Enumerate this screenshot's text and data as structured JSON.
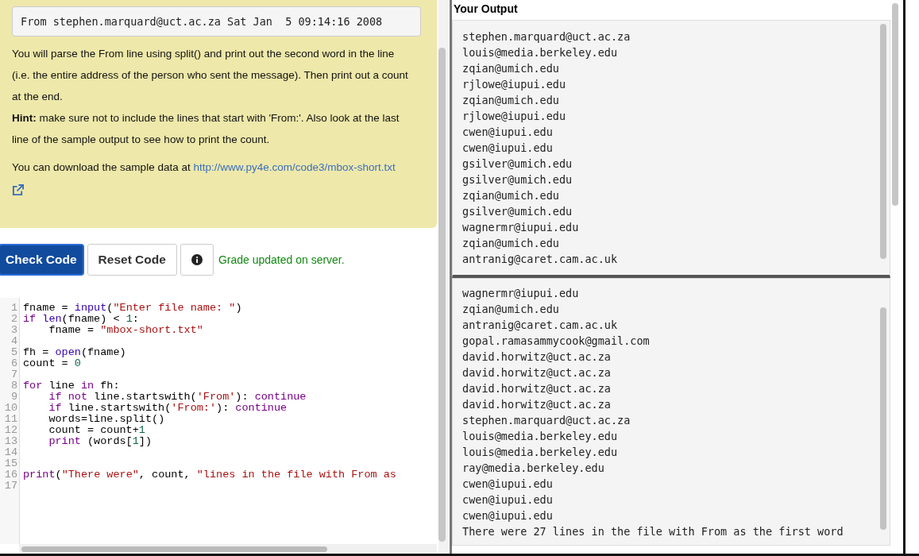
{
  "sample_line": "From stephen.marquard@uct.ac.za Sat Jan  5 09:14:16 2008",
  "instructions": [
    "You will parse the From line using split() and print out the second word in the line (i.e. the entire address of the person who sent the message). Then print out a count at the end.",
    "**Hint:** make sure not to include the lines that start with 'From:'. Also look at the last line of the sample output to see how to print the count."
  ],
  "download": {
    "text": "You can download the sample data at",
    "link": "http://www.py4e.com/code3/mbox-short.txt"
  },
  "buttons": [
    {
      "kind": "primary",
      "label": "Check Code"
    },
    {
      "kind": "default",
      "label": "Reset Code"
    },
    {
      "kind": "info"
    }
  ],
  "status": "Grade updated on server.",
  "code_lines": [
    {
      "number": "1",
      "tokens": [
        {
          "kind": "plain",
          "text": "fname = "
        },
        {
          "kind": "builtin",
          "text": "input"
        },
        {
          "kind": "plain",
          "text": "("
        },
        {
          "kind": "string",
          "text": "\"Enter file name: \""
        },
        {
          "kind": "plain",
          "text": ")"
        }
      ]
    },
    {
      "number": "2",
      "tokens": [
        {
          "kind": "keyword",
          "text": "if"
        },
        {
          "kind": "builtin",
          "text": " len"
        },
        {
          "kind": "plain",
          "text": "(fname) < "
        },
        {
          "kind": "number",
          "text": "1"
        },
        {
          "kind": "plain",
          "text": ":"
        }
      ]
    },
    {
      "number": "3",
      "tokens": [
        {
          "kind": "plain",
          "text": "    fname = "
        },
        {
          "kind": "string",
          "text": "\"mbox-short.txt\""
        }
      ]
    },
    {
      "number": "4"
    },
    {
      "number": "5",
      "tokens": [
        {
          "kind": "plain",
          "text": "fh = "
        },
        {
          "kind": "builtin",
          "text": "open"
        },
        {
          "kind": "plain",
          "text": "(fname)"
        }
      ]
    },
    {
      "number": "6",
      "tokens": [
        {
          "kind": "plain",
          "text": "count = "
        },
        {
          "kind": "number",
          "text": "0"
        }
      ]
    },
    {
      "number": "7"
    },
    {
      "number": "8",
      "tokens": [
        {
          "kind": "keyword",
          "text": "for"
        },
        {
          "kind": "plain",
          "text": " line "
        },
        {
          "kind": "keyword",
          "text": "in"
        },
        {
          "kind": "plain",
          "text": " fh:"
        }
      ]
    },
    {
      "number": "9",
      "indent": true,
      "tokens": [
        {
          "kind": "keyword",
          "text": "if not"
        },
        {
          "kind": "plain",
          "text": " line.startswith("
        },
        {
          "kind": "string",
          "text": "'From'"
        },
        {
          "kind": "plain",
          "text": "): "
        },
        {
          "kind": "keyword",
          "text": "continue"
        }
      ]
    },
    {
      "number": "10",
      "indent": true,
      "tokens": [
        {
          "kind": "keyword",
          "text": "if"
        },
        {
          "kind": "plain",
          "text": " line.startswith("
        },
        {
          "kind": "string",
          "text": "'From:'"
        },
        {
          "kind": "plain",
          "text": "): "
        },
        {
          "kind": "keyword",
          "text": "continue"
        }
      ]
    },
    {
      "number": "11",
      "tokens": [
        {
          "kind": "plain",
          "text": "    words=line.split()"
        }
      ]
    },
    {
      "number": "12",
      "tokens": [
        {
          "kind": "plain",
          "text": "    count = count+"
        },
        {
          "kind": "number",
          "text": "1"
        }
      ]
    },
    {
      "number": "13",
      "indent": true,
      "tokens": [
        {
          "kind": "keyword",
          "text": "print"
        },
        {
          "kind": "plain",
          "text": " (words["
        },
        {
          "kind": "number",
          "text": "1"
        },
        {
          "kind": "plain",
          "text": "])"
        }
      ]
    },
    {
      "number": "14"
    },
    {
      "number": "15"
    },
    {
      "number": "16",
      "tokens": [
        {
          "kind": "keyword",
          "text": "print"
        },
        {
          "kind": "plain",
          "text": "("
        },
        {
          "kind": "string",
          "text": "\"There were\""
        },
        {
          "kind": "plain",
          "text": ", count, "
        },
        {
          "kind": "string",
          "text": "\"lines in the file with From as"
        }
      ]
    },
    {
      "number": "17"
    }
  ],
  "output": {
    "title": "Your Output",
    "panes": [
      [
        "stephen.marquard@uct.ac.za",
        "louis@media.berkeley.edu",
        "zqian@umich.edu",
        "rjlowe@iupui.edu",
        "zqian@umich.edu",
        "rjlowe@iupui.edu",
        "cwen@iupui.edu",
        "cwen@iupui.edu",
        "gsilver@umich.edu",
        "gsilver@umich.edu",
        "zqian@umich.edu",
        "gsilver@umich.edu",
        "wagnermr@iupui.edu",
        "zqian@umich.edu",
        "antranig@caret.cam.ac.uk"
      ],
      [
        "wagnermr@iupui.edu",
        "zqian@umich.edu",
        "antranig@caret.cam.ac.uk",
        "gopal.ramasammycook@gmail.com",
        "david.horwitz@uct.ac.za",
        "david.horwitz@uct.ac.za",
        "david.horwitz@uct.ac.za",
        "david.horwitz@uct.ac.za",
        "stephen.marquard@uct.ac.za",
        "louis@media.berkeley.edu",
        "louis@media.berkeley.edu",
        "ray@media.berkeley.edu",
        "cwen@iupui.edu",
        "cwen@iupui.edu",
        "cwen@iupui.edu",
        "There were 27 lines in the file with From as the first word"
      ]
    ]
  }
}
